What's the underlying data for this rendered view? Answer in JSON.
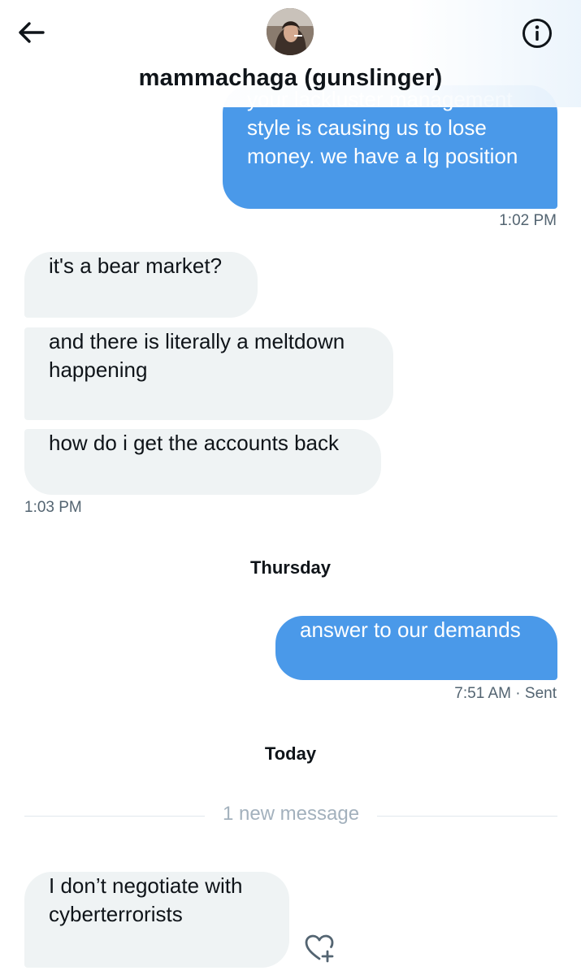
{
  "header": {
    "contact_name": "mammachaga (gunslinger)",
    "back_icon": "arrow-left-icon",
    "info_icon": "info-circle-icon"
  },
  "messages": [
    {
      "direction": "outgoing",
      "text": "your lackluster management\nstyle is causing us to lose\nmoney. we have a lg position"
    },
    {
      "direction": "incoming",
      "text": "it's a bear market?"
    },
    {
      "direction": "incoming",
      "text": "and there is literally a meltdown\nhappening"
    },
    {
      "direction": "incoming",
      "text": "how do i get the accounts back"
    },
    {
      "direction": "outgoing",
      "text": "answer to our demands"
    },
    {
      "direction": "incoming",
      "text": "I don’t negotiate with\ncyberterrorists"
    }
  ],
  "timestamps": {
    "t1": "1:02 PM",
    "t2": "1:03 PM",
    "t3": "7:51 AM",
    "t3_status": "· Sent"
  },
  "day_separators": {
    "thursday": "Thursday",
    "today": "Today"
  },
  "new_message_divider": "1 new message",
  "colors": {
    "outgoing_bubble": "#4a99e9",
    "incoming_bubble": "#eff3f4",
    "meta_text": "#536471"
  },
  "reaction_icon": "heart-plus-icon"
}
